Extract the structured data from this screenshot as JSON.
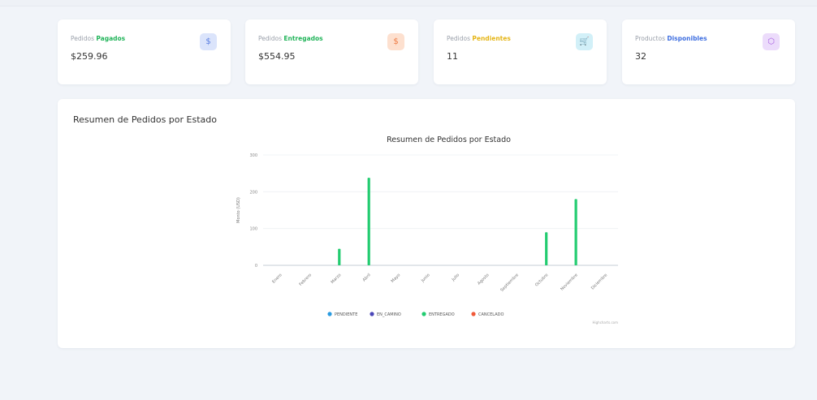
{
  "cards": [
    {
      "label_prefix": "Pedidos",
      "label_highlight": "Pagados",
      "highlight_color": "#22b45a",
      "value": "$259.96",
      "icon": "dollar-icon",
      "icon_glyph": "$",
      "icon_bg": "#dbe4fb",
      "icon_color": "#5a7ee0"
    },
    {
      "label_prefix": "Pedidos",
      "label_highlight": "Entregados",
      "highlight_color": "#22b45a",
      "value": "$554.95",
      "icon": "dollar-icon",
      "icon_glyph": "$",
      "icon_bg": "#fde0cf",
      "icon_color": "#ee7b45"
    },
    {
      "label_prefix": "Pedidos",
      "label_highlight": "Pendientes",
      "highlight_color": "#e5b517",
      "value": "11",
      "icon": "cart-icon",
      "icon_glyph": "🛒",
      "icon_bg": "#d2f0f8",
      "icon_color": "#2cb3d6"
    },
    {
      "label_prefix": "Productos",
      "label_highlight": "Disponibles",
      "highlight_color": "#3f6fe0",
      "value": "32",
      "icon": "box-icon",
      "icon_glyph": "⬡",
      "icon_bg": "#ecdcfb",
      "icon_color": "#a55be0"
    }
  ],
  "panel": {
    "title": "Resumen de Pedidos por Estado"
  },
  "chart_data": {
    "type": "bar",
    "title": "Resumen de Pedidos por Estado",
    "ylabel": "Monto (USD)",
    "xlabel": "",
    "ylim": [
      0,
      300
    ],
    "yticks": [
      0,
      100,
      200,
      300
    ],
    "grid": true,
    "legend_position": "bottom",
    "categories": [
      "Enero",
      "Febrero",
      "Marzo",
      "Abril",
      "Mayo",
      "Junio",
      "Julio",
      "Agosto",
      "Septiembre",
      "Octubre",
      "Noviembre",
      "Diciembre"
    ],
    "series": [
      {
        "name": "PENDIENTE",
        "color": "#2a9be0",
        "values": [
          0,
          0,
          0,
          0,
          0,
          0,
          0,
          0,
          0,
          0,
          0,
          0
        ]
      },
      {
        "name": "EN_CAMINO",
        "color": "#4a46b8",
        "values": [
          0,
          0,
          0,
          0,
          0,
          0,
          0,
          0,
          0,
          0,
          0,
          0
        ]
      },
      {
        "name": "ENTREGADO",
        "color": "#22cc70",
        "values": [
          0,
          0,
          45,
          238,
          0,
          0,
          0,
          0,
          0,
          90,
          180,
          0
        ]
      },
      {
        "name": "CANCELADO",
        "color": "#f05a3a",
        "values": [
          0,
          0,
          0,
          0,
          0,
          0,
          0,
          0,
          0,
          0,
          0,
          0
        ]
      }
    ],
    "credit": "Highcharts.com"
  }
}
